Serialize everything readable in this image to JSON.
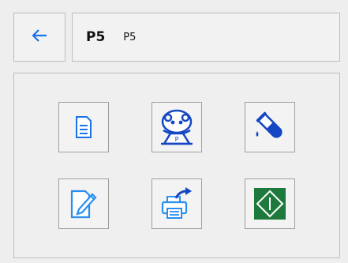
{
  "header": {
    "back_icon": "arrow-left-icon",
    "title": "P5",
    "subtitle": "P5"
  },
  "colors": {
    "accent": "#1a73e8",
    "icon_blue": "#1547c4",
    "icon_light_blue": "#2a8ef0",
    "green": "#1e7a3c"
  },
  "tiles": [
    {
      "icon": "document-icon"
    },
    {
      "icon": "operator-face-icon"
    },
    {
      "icon": "test-tube-icon"
    },
    {
      "icon": "edit-note-icon"
    },
    {
      "icon": "print-share-icon"
    },
    {
      "icon": "start-diamond-icon"
    }
  ]
}
